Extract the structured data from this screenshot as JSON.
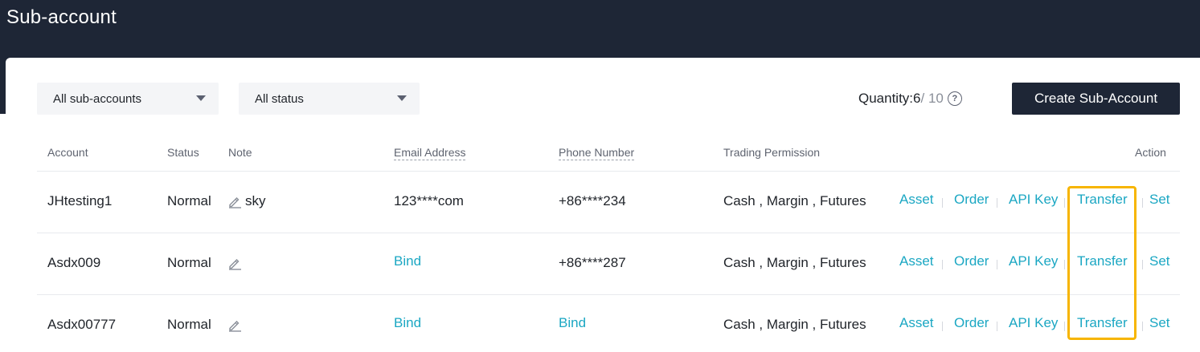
{
  "page": {
    "title": "Sub-account"
  },
  "filters": {
    "account_select": "All sub-accounts",
    "status_select": "All status"
  },
  "quantity": {
    "label": "Quantity: ",
    "used": "6",
    "total": " / 10"
  },
  "create_button": "Create Sub-Account",
  "table": {
    "headers": {
      "account": "Account",
      "status": "Status",
      "note": "Note",
      "email": "Email Address",
      "phone": "Phone Number",
      "permission": "Trading Permission",
      "action": "Action"
    },
    "rows": [
      {
        "account": "JHtesting1",
        "status": "Normal",
        "note": "sky",
        "email": "123****com",
        "email_is_link": false,
        "phone": "+86****234",
        "phone_is_link": false,
        "permission": "Cash , Margin , Futures"
      },
      {
        "account": "Asdx009",
        "status": "Normal",
        "note": "",
        "email": "Bind",
        "email_is_link": true,
        "phone": "+86****287",
        "phone_is_link": false,
        "permission": "Cash , Margin , Futures"
      },
      {
        "account": "Asdx00777",
        "status": "Normal",
        "note": "",
        "email": "Bind",
        "email_is_link": true,
        "phone": "Bind",
        "phone_is_link": true,
        "permission": "Cash , Margin , Futures"
      }
    ],
    "actions": [
      "Asset",
      "Order",
      "API Key",
      "Transfer",
      "Set"
    ]
  },
  "colors": {
    "header_bg": "#1e2636",
    "link": "#1ba7c3",
    "highlight": "#f7b500"
  }
}
